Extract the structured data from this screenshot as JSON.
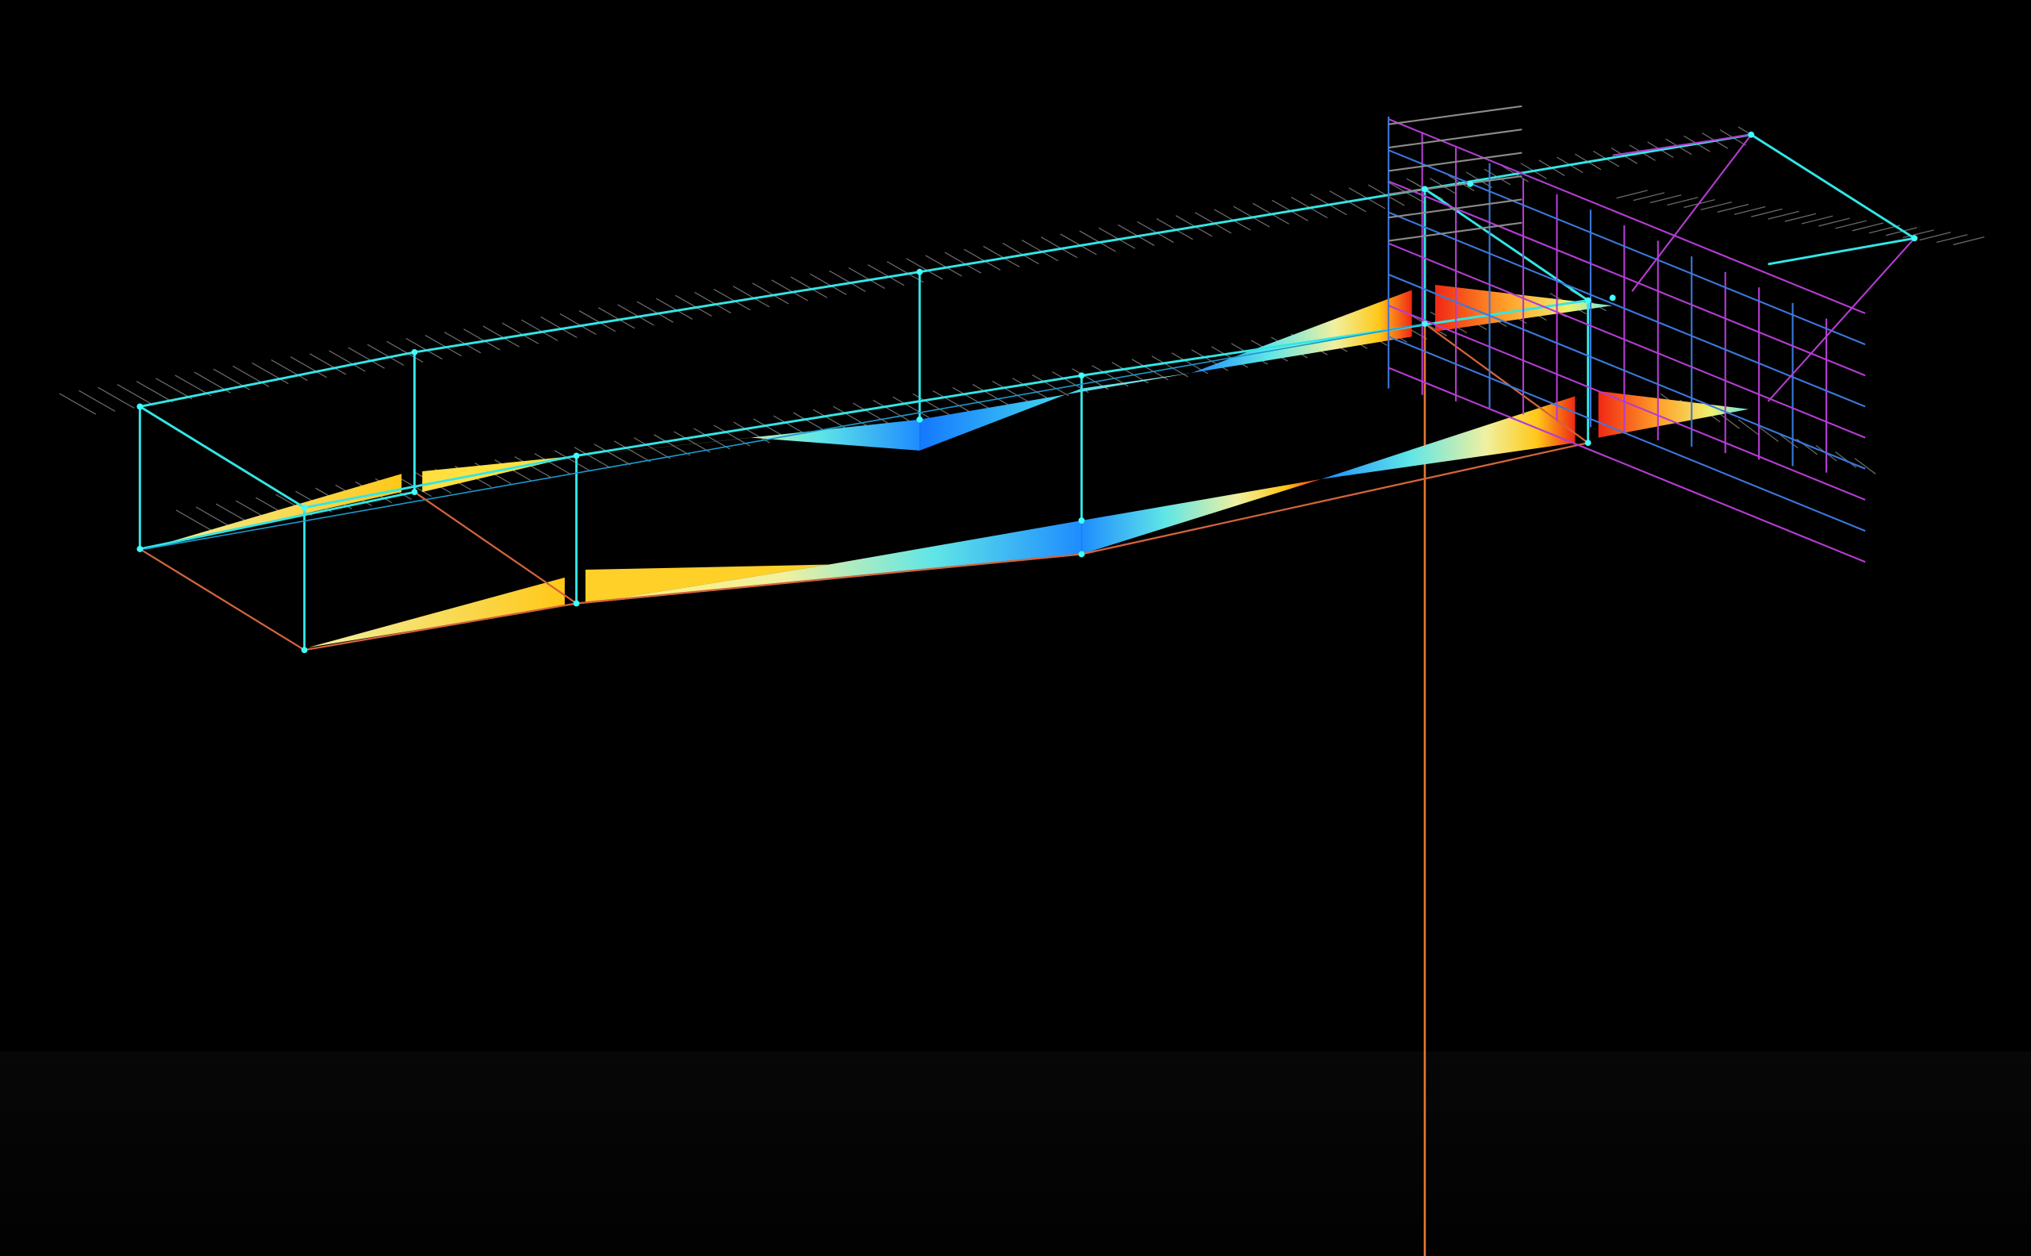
{
  "viewport": {
    "background": "#000000",
    "view": "3d-isometric",
    "content": "structural-frame-force-diagram"
  },
  "colors": {
    "frame": "#33e6e6",
    "frame_dark": "#1a99cc",
    "grid": "#8a8a8a",
    "scaffold": "#b43cd2",
    "scaffold_blue": "#3c78dc",
    "column": "#e67832",
    "lower_frame": "#d2643c",
    "gradient_low": "#1478ff",
    "gradient_mid_low": "#3ce6e6",
    "gradient_mid": "#f0f050",
    "gradient_mid_high": "#ffa028",
    "gradient_high": "#f01e14",
    "node": "#40ffff"
  },
  "elements": {
    "top_beam_front": "top-frame-beam",
    "top_beam_back": "upper-rail",
    "lower_beam": "lower-beam",
    "columns": 4,
    "force_diagrams": 6,
    "scaffold_grid": "scaffold-tower"
  }
}
